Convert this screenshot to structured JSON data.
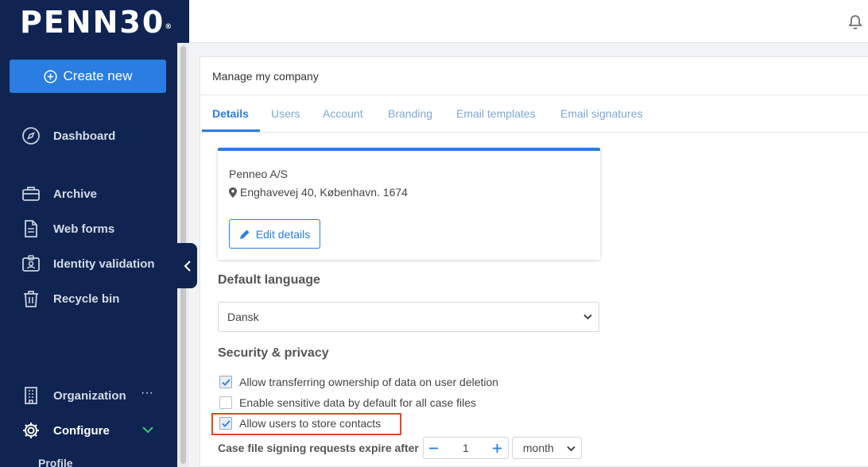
{
  "brand": {
    "logo_text": "PENN30",
    "logo_mark": "®"
  },
  "sidebar": {
    "create_label": "Create new",
    "items": [
      {
        "label": "Dashboard",
        "icon": "compass-icon"
      },
      {
        "label": "Archive",
        "icon": "briefcase-icon"
      },
      {
        "label": "Web forms",
        "icon": "document-icon"
      },
      {
        "label": "Identity validation",
        "icon": "id-badge-icon"
      },
      {
        "label": "Recycle bin",
        "icon": "trash-icon"
      },
      {
        "label": "Organization",
        "icon": "building-icon"
      },
      {
        "label": "Configure",
        "icon": "gear-icon"
      }
    ],
    "more_label": "···",
    "subitem_label": "Profile"
  },
  "page": {
    "title": "Manage my company",
    "tabs": [
      "Details",
      "Users",
      "Account",
      "Branding",
      "Email templates",
      "Email signatures"
    ],
    "active_tab": "Details"
  },
  "company": {
    "name": "Penneo A/S",
    "address": "Enghavevej 40, København. 1674",
    "edit_label": "Edit details"
  },
  "language": {
    "heading": "Default language",
    "selected": "Dansk"
  },
  "security": {
    "heading": "Security & privacy",
    "options": [
      {
        "label": "Allow transferring ownership of data on user deletion",
        "checked": true
      },
      {
        "label": "Enable sensitive data by default for all case files",
        "checked": false
      },
      {
        "label": "Allow users to store contacts",
        "checked": true
      }
    ],
    "expire_label": "Case file signing requests expire after",
    "expire_value": "1",
    "expire_unit": "month"
  },
  "colors": {
    "sidebar_bg": "#0f2451",
    "accent": "#2a7de1",
    "highlight": "#e0481f",
    "configure_chevron": "#3ec46d"
  }
}
